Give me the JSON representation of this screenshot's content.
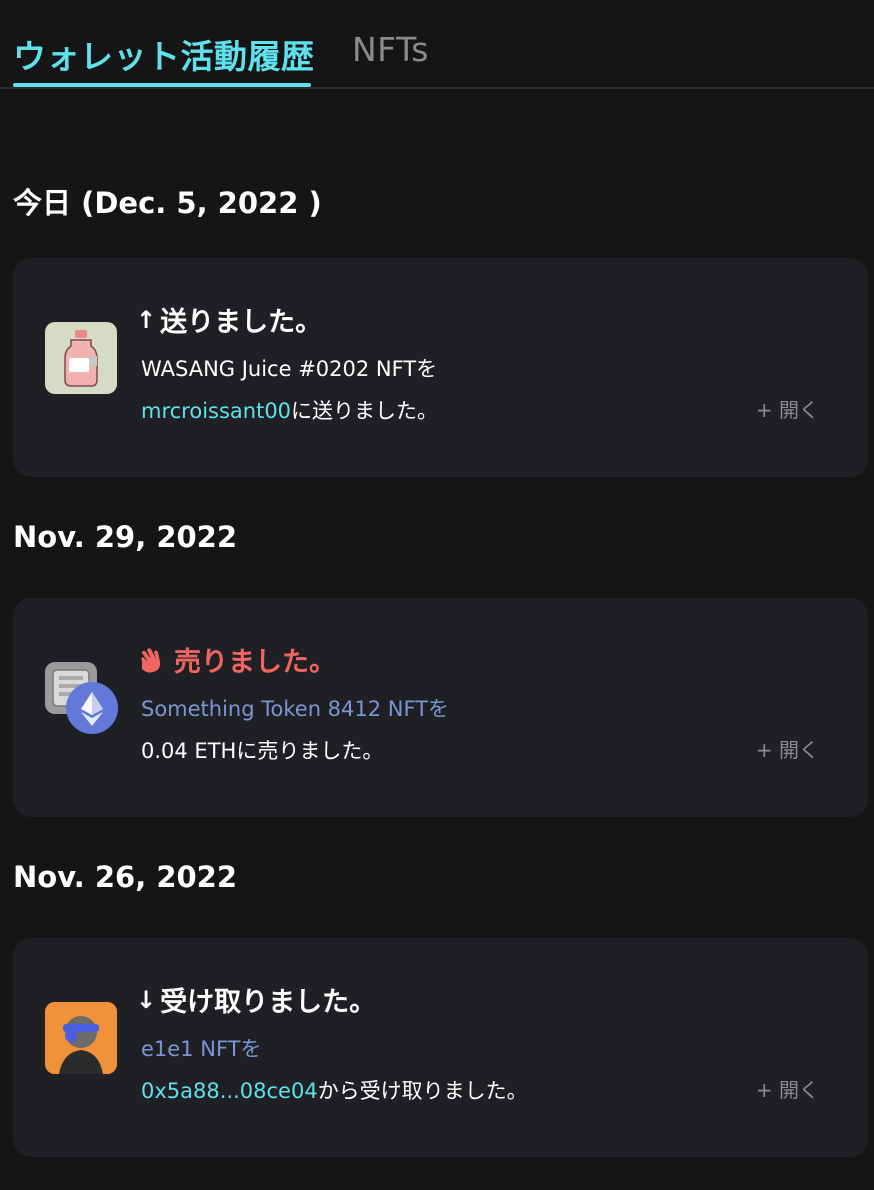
{
  "tabs": [
    {
      "label": "ウォレット活動履歴",
      "active": true
    },
    {
      "label": "NFTs",
      "active": false
    }
  ],
  "groups": [
    {
      "date": "今日 (Dec. 5, 2022 )",
      "activity": {
        "arrow": "↑",
        "title": "送りました。",
        "line1": "WASANG Juice #0202 NFTを",
        "line2_link": "mrcroissant00",
        "line2_rest": "に送りました。",
        "open_label": "+ 開く"
      }
    },
    {
      "date": "Nov. 29, 2022",
      "activity": {
        "title": "売りました。",
        "line1": "Something Token 8412 NFTを",
        "line2": "0.04 ETHに売りました。",
        "open_label": "+ 開く"
      }
    },
    {
      "date": "Nov. 26, 2022",
      "activity": {
        "arrow": "↓",
        "title": "受け取りました。",
        "line1": "e1e1 NFTを",
        "line2_link": "0x5a88...08ce04",
        "line2_rest": "から受け取りました。",
        "open_label": "+ 開く"
      }
    }
  ],
  "colors": {
    "background": "#151516",
    "card": "#1f2024",
    "accent_cyan": "#5fe1ec",
    "link_blue": "#7b95d6",
    "sold_red": "#f06462",
    "muted": "#8a8b8f"
  },
  "icons": [
    "arrow-up-icon",
    "waving-hand-icon",
    "ethereum-icon",
    "arrow-down-icon"
  ]
}
